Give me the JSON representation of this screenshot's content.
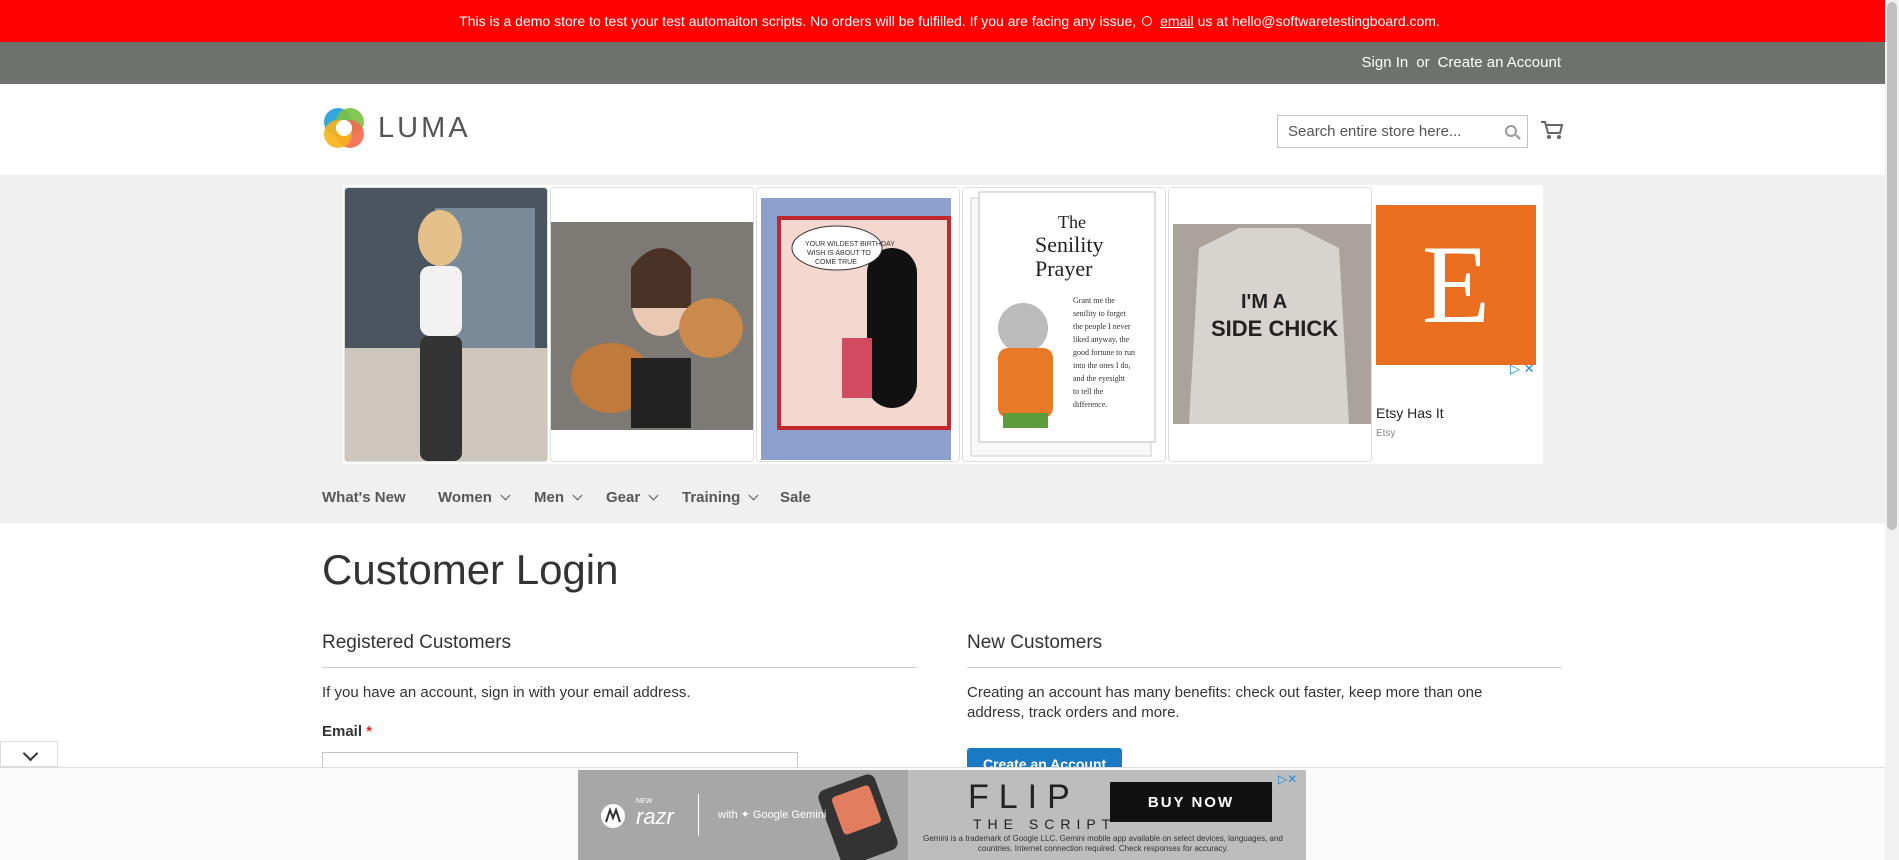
{
  "demo_notice": {
    "text_before": "This is a demo store to test your test automaiton scripts. No orders will be fulfilled. If you are facing any issue,",
    "link": "email",
    "text_after": "us at hello@softwaretestingboard.com."
  },
  "header_links": {
    "sign_in": "Sign In",
    "or": "or",
    "create_account": "Create an Account"
  },
  "logo": {
    "text": "LUMA"
  },
  "search": {
    "placeholder": "Search entire store here..."
  },
  "ad": {
    "etsy_letter": "E",
    "etsy_title": "Etsy Has It",
    "etsy_sub": "Etsy",
    "card2_text": "The Senility Prayer",
    "card2_body": "Grant me the senility to forget the people I never liked anyway, the good fortune to run into the ones I do, and the eyesight to tell the difference.",
    "card1_text": "YOUR WILDEST BIRTHDAY WISH IS ABOUT TO COME TRUE",
    "shirt_text": "I'M A SIDE CHICK"
  },
  "nav": {
    "items": [
      "What's New",
      "Women",
      "Men",
      "Gear",
      "Training",
      "Sale"
    ]
  },
  "page": {
    "title": "Customer Login",
    "registered": {
      "title": "Registered Customers",
      "note": "If you have an account, sign in with your email address.",
      "email_label": "Email",
      "required_mark": "*"
    },
    "new": {
      "title": "New Customers",
      "note": "Creating an account has many benefits: check out faster, keep more than one address, track orders and more.",
      "button": "Create an Account"
    }
  },
  "bottom_ad": {
    "brand_small": "NEW",
    "brand": "razr",
    "with": "with ✦ Google Gemini",
    "headline": "FLIP",
    "subline": "THE SCRIPT",
    "cta": "BUY NOW",
    "disclaimer": "Gemini is a trademark of Google LLC. Gemini mobile app available on select devices, languages, and countries. Internet connection required. Check responses for accuracy."
  },
  "colors": {
    "demo_bar": "#ff0101",
    "panel": "#6e716e",
    "accent": "#1979c3",
    "etsy": "#ea6e1f"
  }
}
